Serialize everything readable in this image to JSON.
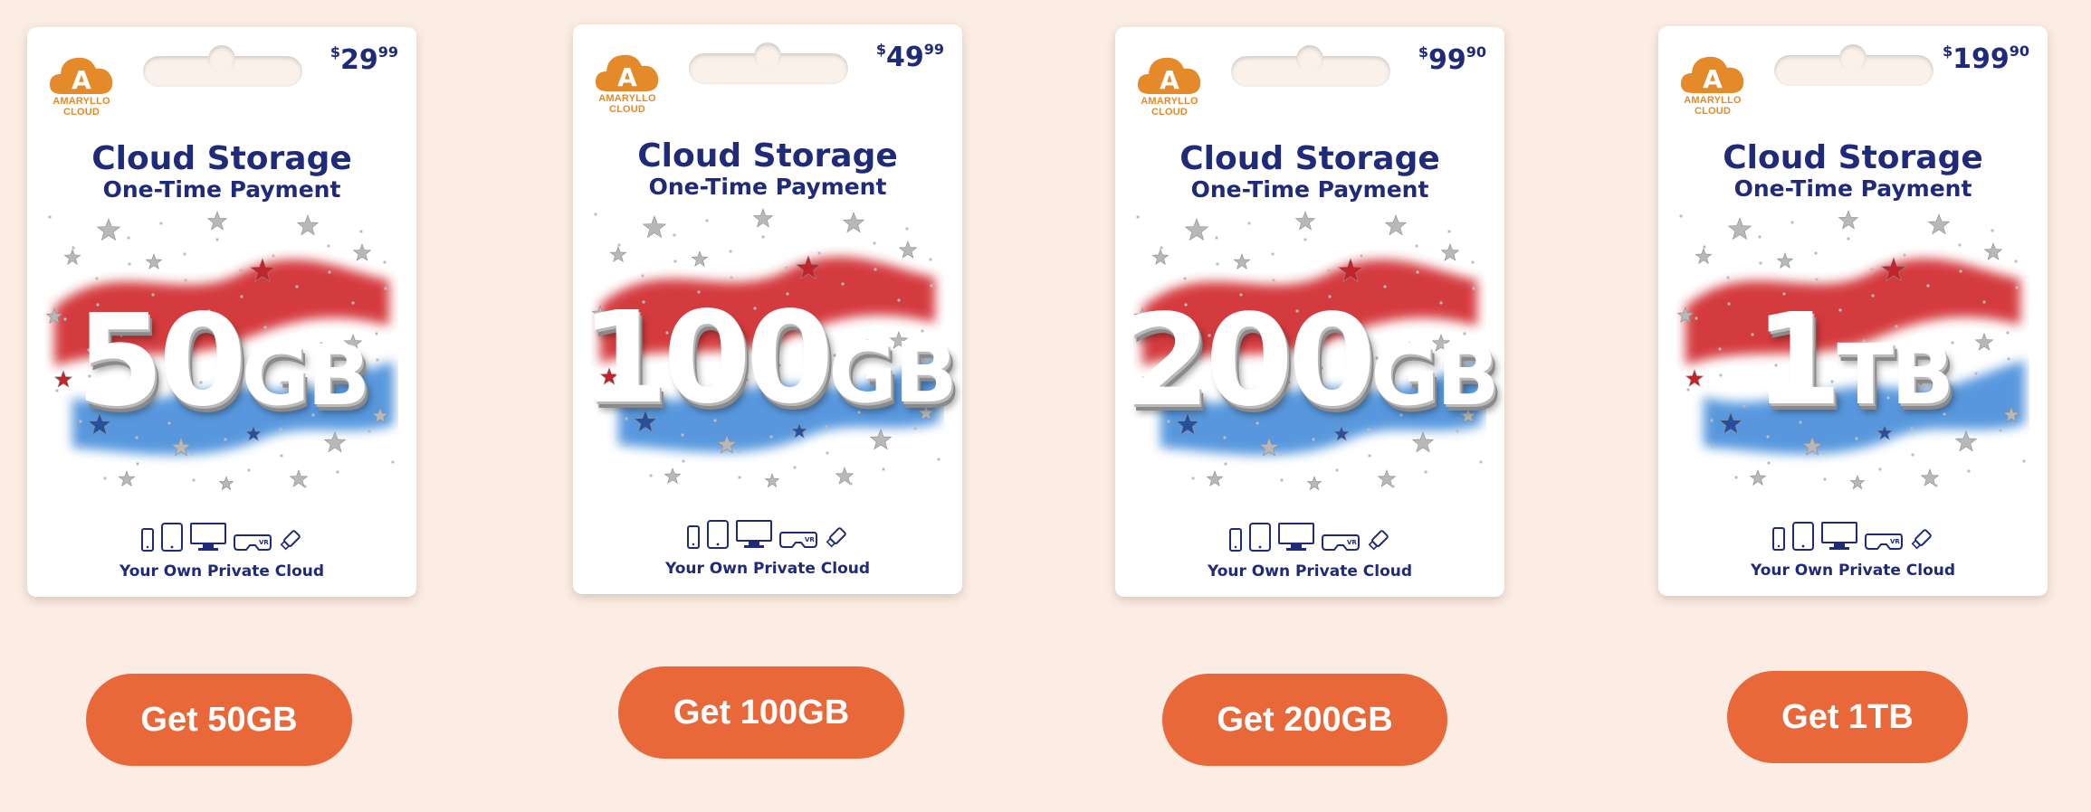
{
  "brand": {
    "logo_text": "AMARYLLO CLOUD",
    "logo_letter": "A"
  },
  "card_title": "Cloud Storage",
  "card_subtitle": "One-Time Payment",
  "card_tagline": "Your Own Private Cloud",
  "colors": {
    "page_bg": "#fbece4",
    "navy": "#1f2a78",
    "orange": "#e58a2a",
    "button": "#e8683a",
    "flag_red": "#d0282c",
    "flag_blue": "#3a86d8"
  },
  "device_icons": [
    "phone-icon",
    "tablet-icon",
    "monitor-icon",
    "vr-headset-icon",
    "usb-drive-icon"
  ],
  "plans": [
    {
      "currency": "$",
      "price_main": "29",
      "price_cents": "99",
      "capacity_num": "50",
      "capacity_unit": "GB",
      "button": "Get 50GB"
    },
    {
      "currency": "$",
      "price_main": "49",
      "price_cents": "99",
      "capacity_num": "100",
      "capacity_unit": "GB",
      "button": "Get 100GB"
    },
    {
      "currency": "$",
      "price_main": "99",
      "price_cents": "90",
      "capacity_num": "200",
      "capacity_unit": "GB",
      "button": "Get 200GB"
    },
    {
      "currency": "$",
      "price_main": "199",
      "price_cents": "90",
      "capacity_num": "1",
      "capacity_unit": "TB",
      "button": "Get 1TB"
    }
  ]
}
